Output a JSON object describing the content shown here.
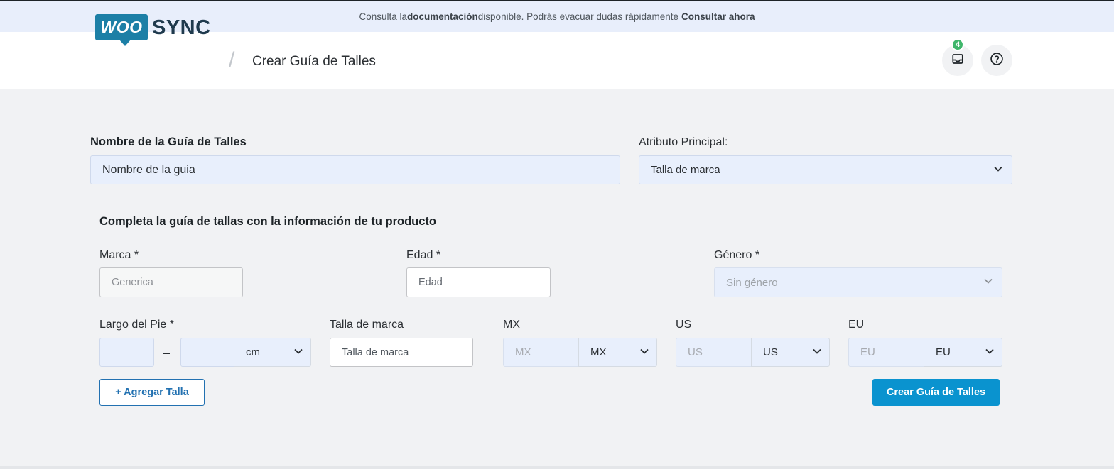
{
  "notice": {
    "prefix": "Consulta la ",
    "highlight": "documentación",
    "middle": " disponible. Podrás evacuar dudas rápidamente",
    "link": "Consultar ahora"
  },
  "header": {
    "logo_left": "WOO",
    "logo_right": "SYNC",
    "page_title": "Crear Guía de Talles",
    "inbox_count": "4",
    "icons": [
      "inbox-icon",
      "help-circle-icon"
    ]
  },
  "form": {
    "guide_name_label": "Nombre de la Guía de Talles",
    "guide_name_value": "Nombre de la guia",
    "main_attribute_label": "Atributo Principal:",
    "main_attribute_value": "Talla de marca",
    "section_title": "Completa la guía de tallas con la información de tu producto",
    "marca_label": "Marca *",
    "marca_placeholder": "Generica",
    "edad_label": "Edad *",
    "edad_placeholder": "Edad",
    "genero_label": "Género *",
    "genero_value": "Sin género",
    "largo_label": "Largo del Pie *",
    "largo_unit": "cm",
    "talla_label": "Talla de marca",
    "talla_placeholder": "Talla de marca",
    "mx_label": "MX",
    "mx_placeholder": "MX",
    "mx_unit": "MX",
    "us_label": "US",
    "us_placeholder": "US",
    "us_unit": "US",
    "eu_label": "EU",
    "eu_placeholder": "EU",
    "eu_unit": "EU"
  },
  "actions": {
    "add_size": "+ Agregar Talla",
    "create": "Crear Guía de Talles"
  },
  "colors": {
    "accent": "#0a93cf",
    "brand": "#1c7fa6",
    "badge": "#3fb66b",
    "field_bg": "#e8effc"
  }
}
